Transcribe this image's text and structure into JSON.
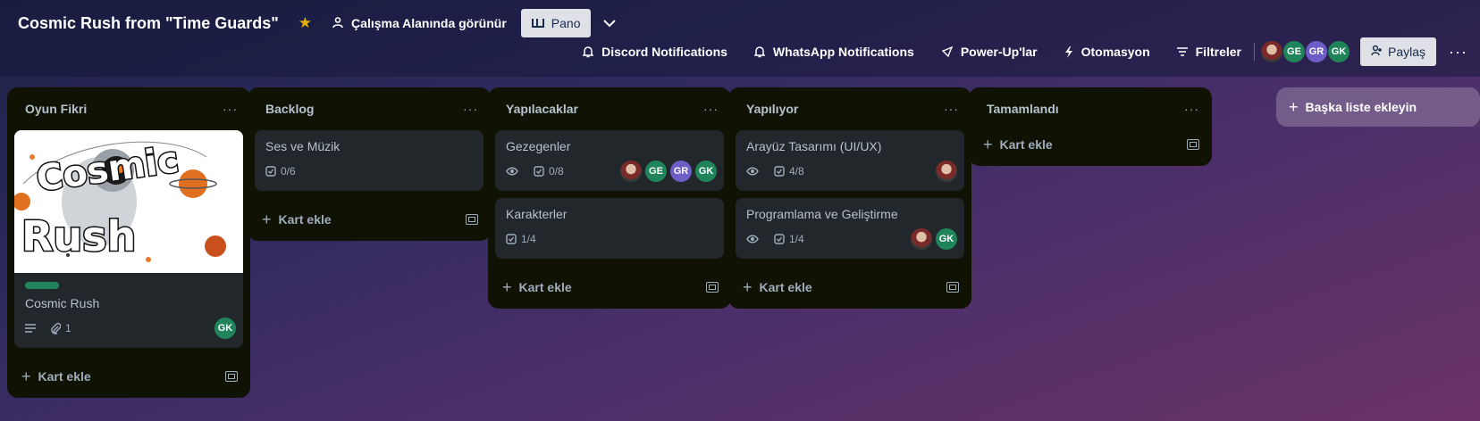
{
  "header": {
    "board_title": "Cosmic Rush from \"Time Guards\"",
    "visibility_label": "Çalışma Alanında görünür",
    "view_label": "Pano",
    "tools": {
      "discord": "Discord Notifications",
      "whatsapp": "WhatsApp Notifications",
      "powerups": "Power-Up'lar",
      "automation": "Otomasyon",
      "filters": "Filtreler"
    },
    "members": [
      "GE",
      "GR",
      "GK"
    ],
    "share_label": "Paylaş"
  },
  "lists": [
    {
      "title": "Oyun Fikri",
      "cards": [
        {
          "title": "Cosmic Rush",
          "cover_text_top": "Cosmic",
          "cover_text_bottom": "Rush",
          "label_color": "#1f845a",
          "attachments": "1",
          "members": [
            "GK"
          ]
        }
      ],
      "add_card": "Kart ekle"
    },
    {
      "title": "Backlog",
      "cards": [
        {
          "title": "Ses ve Müzik",
          "checklist": "0/6"
        }
      ],
      "add_card": "Kart ekle"
    },
    {
      "title": "Yapılacaklar",
      "cards": [
        {
          "title": "Gezegenler",
          "checklist": "0/8",
          "members": [
            "GE",
            "GR",
            "GK"
          ]
        },
        {
          "title": "Karakterler",
          "checklist": "1/4"
        }
      ],
      "add_card": "Kart ekle"
    },
    {
      "title": "Yapılıyor",
      "cards": [
        {
          "title": "Arayüz Tasarımı (UI/UX)",
          "checklist": "4/8"
        },
        {
          "title": "Programlama ve Geliştirme",
          "checklist": "1/4",
          "members": [
            "GK"
          ]
        }
      ],
      "add_card": "Kart ekle"
    },
    {
      "title": "Tamamlandı",
      "cards": [],
      "add_card": "Kart ekle"
    }
  ],
  "add_list_label": "Başka liste ekleyin",
  "colors": {
    "list_bg": "#101204",
    "card_bg": "#22272b",
    "star": "#e2b203",
    "member_green": "#1f845a",
    "member_purple": "#6e5dc6"
  }
}
